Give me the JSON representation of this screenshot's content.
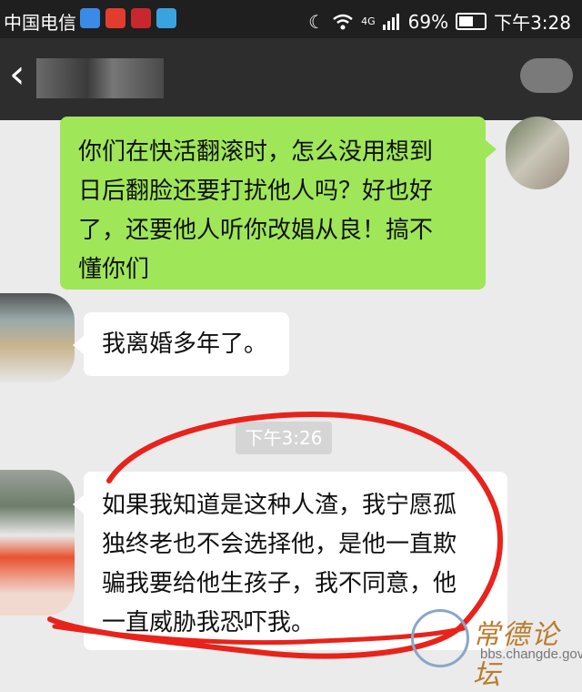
{
  "status_bar": {
    "carrier": "中国电信",
    "network": "4G",
    "battery_percent": "69%",
    "battery_level": 0.69,
    "time": "下午3:28",
    "icons": [
      "qq-icon",
      "weibo-icon",
      "netease-news-icon",
      "telegram-icon",
      "moon-icon",
      "wifi-icon",
      "signal-icon",
      "battery-icon"
    ]
  },
  "nav": {
    "back_icon": "chevron-left-icon"
  },
  "messages": [
    {
      "side": "right",
      "text_lines": [
        "你们在快活翻滚时，怎么没用想到",
        "日后翻脸还要打扰他人吗？好也好",
        "了，还要他人听你改娼从良！搞不",
        "懂你们"
      ]
    },
    {
      "side": "left",
      "text": "我离婚多年了。"
    },
    {
      "side": "left",
      "text_lines": [
        "如果我知道是这种人渣，我宁愿孤",
        "独终老也不会选择他，是他一直欺",
        "骗我要给他生孩子，我不同意，他",
        "一直威胁我恐吓我。"
      ]
    }
  ],
  "timestamp": "下午3:26",
  "watermark": {
    "site_name": "常德论坛",
    "url": "bbs.changde.gov.cn"
  },
  "colors": {
    "sent_bubble": "#9fe658",
    "annotation": "#e8231b",
    "nav_bg": "#2d2d2d"
  }
}
